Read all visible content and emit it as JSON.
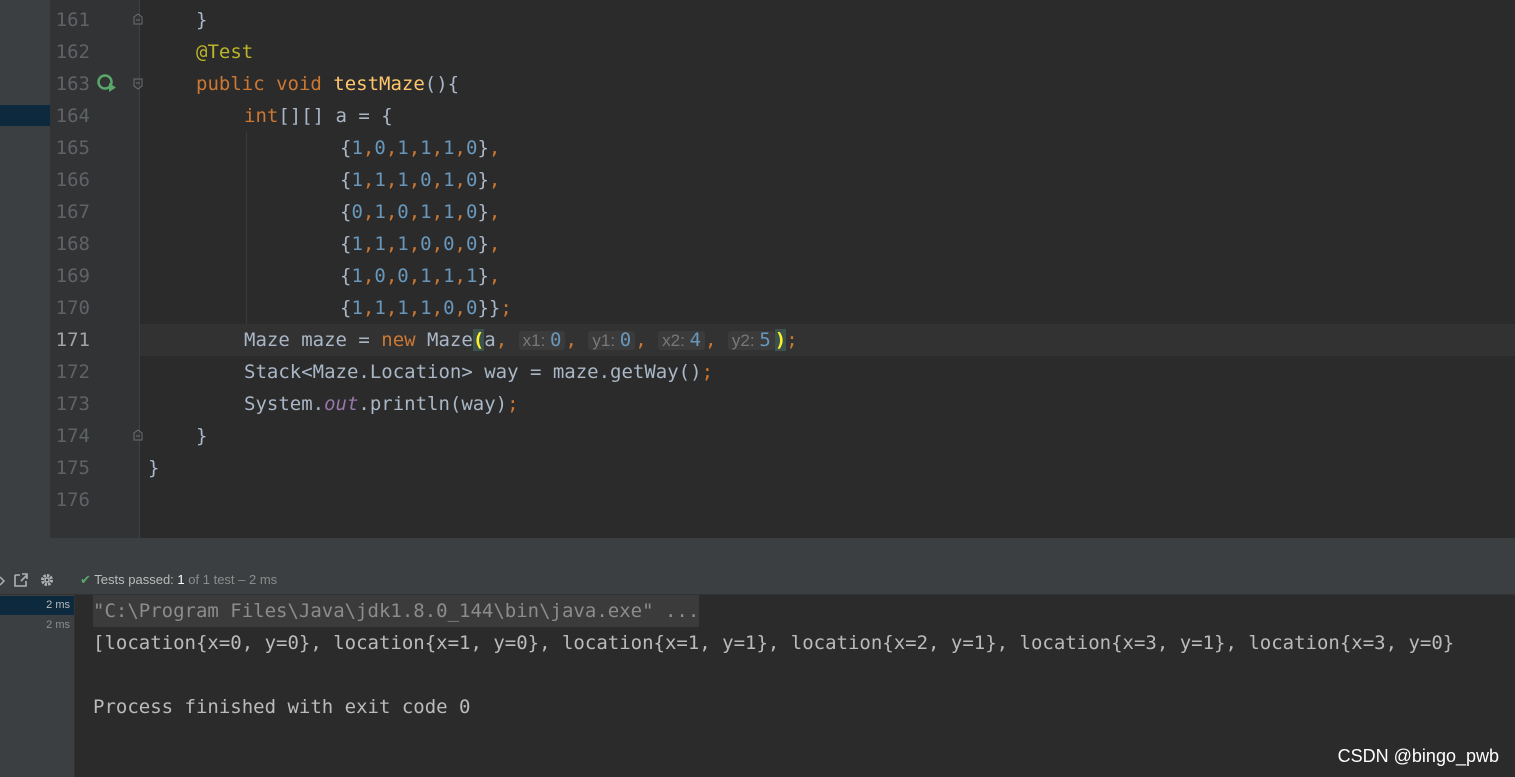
{
  "editor": {
    "line_numbers": [
      "161",
      "162",
      "163",
      "164",
      "165",
      "166",
      "167",
      "168",
      "169",
      "170",
      "171",
      "172",
      "173",
      "174",
      "175",
      "176"
    ],
    "lines": {
      "l161": "}",
      "l162_annotation": "@Test",
      "l163_kw": "public void ",
      "l163_method": "testMaze",
      "l163_rest": "(){",
      "l164_kw": "int",
      "l164_rest": "[][] a = {",
      "rows": [
        [
          "1",
          "0",
          "1",
          "1",
          "1",
          "0"
        ],
        [
          "1",
          "1",
          "1",
          "0",
          "1",
          "0"
        ],
        [
          "0",
          "1",
          "0",
          "1",
          "1",
          "0"
        ],
        [
          "1",
          "1",
          "1",
          "0",
          "0",
          "0"
        ],
        [
          "1",
          "0",
          "0",
          "1",
          "1",
          "1"
        ],
        [
          "1",
          "1",
          "1",
          "1",
          "0",
          "0"
        ]
      ],
      "l171_a": "Maze maze = ",
      "l171_new": "new",
      "l171_b": " Maze",
      "l171_open": "(",
      "l171_arg": "a",
      "l171_hint_x1": "x1:",
      "l171_val_x1": "0",
      "l171_hint_y1": "y1:",
      "l171_val_y1": "0",
      "l171_hint_x2": "x2:",
      "l171_val_x2": "4",
      "l171_hint_y2": "y2:",
      "l171_val_y2": "5",
      "l171_close": ")",
      "l172": "Stack<Maze.Location> way = maze.getWay()",
      "l173_a": "System.",
      "l173_field": "out",
      "l173_b": ".println(way)",
      "l174": "}",
      "l175": "}"
    }
  },
  "run_panel": {
    "status_label": "Tests passed:",
    "status_count": "1",
    "status_detail": "of 1 test – 2 ms",
    "tree_times": [
      "2 ms",
      "2 ms"
    ],
    "console_lines": [
      "\"C:\\Program Files\\Java\\jdk1.8.0_144\\bin\\java.exe\" ...",
      "[location{x=0, y=0}, location{x=1, y=0}, location{x=1, y=1}, location{x=2, y=1}, location{x=3, y=1}, location{x=3, y=0}",
      "Process finished with exit code 0"
    ]
  },
  "watermark": "CSDN @bingo_pwb",
  "colors": {
    "background": "#2b2b2b",
    "keyword": "#cc7832",
    "number": "#6897bb",
    "annotation": "#bbb529",
    "method": "#ffc66d",
    "text": "#a9b7c6"
  },
  "icons": [
    "run-test-icon",
    "fold-icon",
    "export-icon",
    "settings-icon",
    "check-icon"
  ]
}
